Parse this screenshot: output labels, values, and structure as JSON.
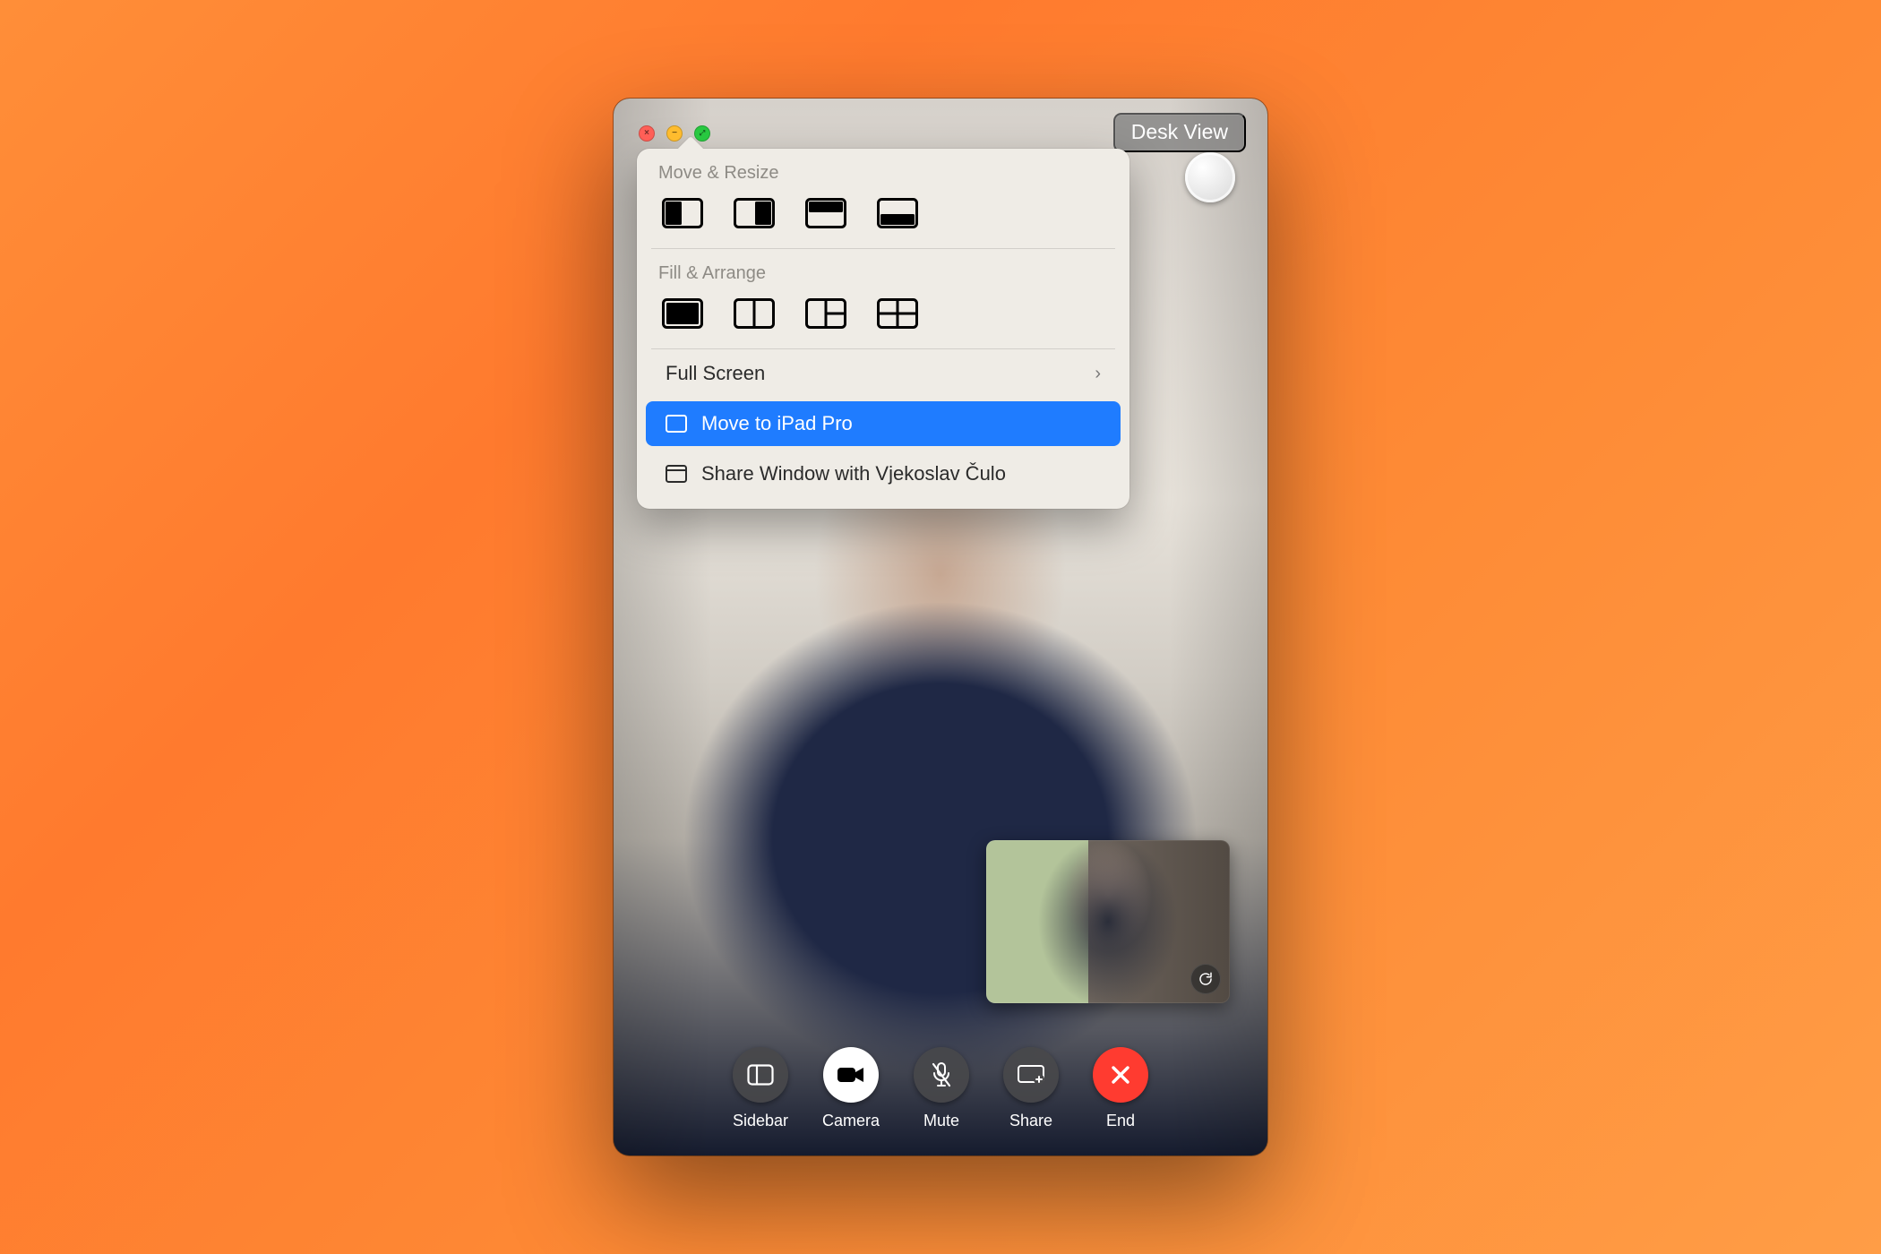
{
  "header": {
    "desk_view_label": "Desk View"
  },
  "popover": {
    "move_resize_label": "Move & Resize",
    "fill_arrange_label": "Fill & Arrange",
    "full_screen_label": "Full Screen",
    "move_to_label": "Move to iPad Pro",
    "share_window_label": "Share Window with Vjekoslav Čulo"
  },
  "controls": {
    "sidebar": "Sidebar",
    "camera": "Camera",
    "mute": "Mute",
    "share": "Share",
    "end": "End"
  }
}
